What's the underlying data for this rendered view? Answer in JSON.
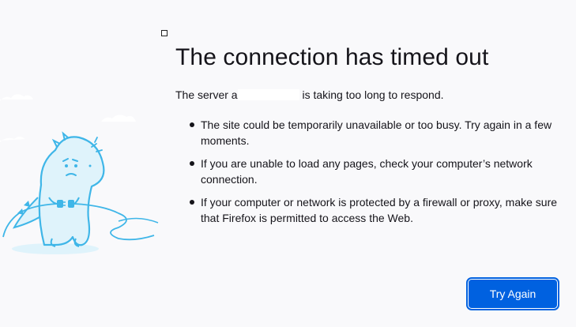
{
  "error": {
    "title": "The connection has timed out",
    "server_prefix": "The server a",
    "server_suffix": " is taking too long to respond.",
    "bullets": [
      "The site could be temporarily unavailable or too busy. Try again in a few moments.",
      "If you are unable to load any pages, check your computer’s network connection.",
      "If your computer or network is protected by a firewall or proxy, make sure that Firefox is permitted to access the Web."
    ]
  },
  "actions": {
    "try_again_label": "Try Again"
  },
  "colors": {
    "background": "#f9f9fb",
    "accent": "#0061e0",
    "illustration_stroke": "#3fb6e8",
    "illustration_fill": "#dff3fb"
  },
  "icons": {
    "illustration": "dino-unplugged-illustration",
    "corner": "small-square-icon"
  }
}
